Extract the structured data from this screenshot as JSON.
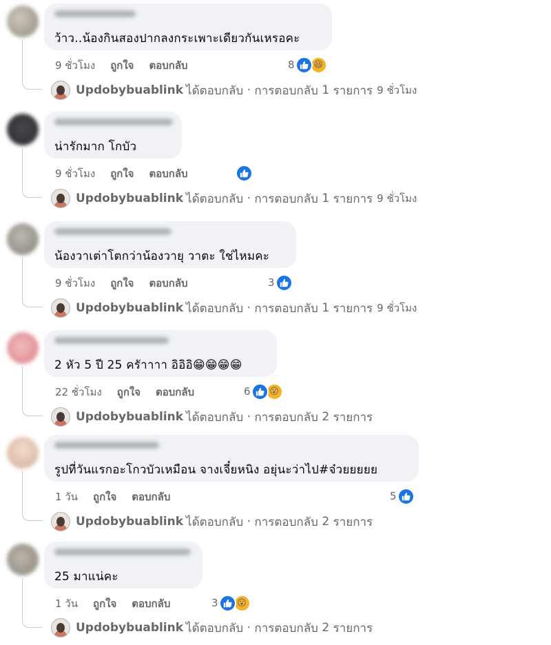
{
  "actions": {
    "like": "ถูกใจ",
    "reply": "ตอบกลับ"
  },
  "reply_line": {
    "name": "Updobybuablink",
    "replied": "ได้ตอบกลับ",
    "sep": "·",
    "count_prefix": "การตอบกลับ",
    "count_suffix": "รายการ"
  },
  "colors": {
    "like": "#1b74e4",
    "bubble": "#f0f2f5",
    "meta": "#65676b"
  },
  "comments": [
    {
      "text": "ว้าว..น้องกินสองปากลงกระเพาะเดียวกันเหรอคะ",
      "time": "9 ชั่วโมง",
      "reaction_count": "8",
      "reaction_icons": [
        "like-icon",
        "laugh-icon"
      ],
      "reply_count": "1",
      "reply_time": "9 ชั่วโมง"
    },
    {
      "text": "น่ารักมาก โกบัว",
      "time": "9 ชั่วโมง",
      "reaction_count": "",
      "reaction_icons": [
        "like-icon"
      ],
      "reply_count": "1",
      "reply_time": "9 ชั่วโมง"
    },
    {
      "text": "น้องวาเต่าโตกว่าน้องวายุ วาตะ ใช่ไหมคะ",
      "time": "9 ชั่วโมง",
      "reaction_count": "3",
      "reaction_icons": [
        "like-icon"
      ],
      "reply_count": "1",
      "reply_time": "9 ชั่วโมง"
    },
    {
      "text": "2 หัว 5 ปี 25 ครัาาาา อิอิอิ😁😁😁😁",
      "time": "22 ชั่วโมง",
      "reaction_count": "6",
      "reaction_icons": [
        "like-icon",
        "wow-icon"
      ],
      "reply_count": "2",
      "reply_time": ""
    },
    {
      "text": "รูปที่วันแรกอะโกวบัวเหมือน จางเจี๋ยหนิง อยุ่นะว่าไป#จ๋วยยยยย",
      "time": "1 วัน",
      "reaction_count": "5",
      "reaction_icons": [
        "like-icon"
      ],
      "reply_count": "2",
      "reply_time": ""
    },
    {
      "text": "25 มาแน่คะ",
      "time": "1 วัน",
      "reaction_count": "3",
      "reaction_icons": [
        "like-icon",
        "wow-icon"
      ],
      "reply_count": "2",
      "reply_time": ""
    }
  ]
}
